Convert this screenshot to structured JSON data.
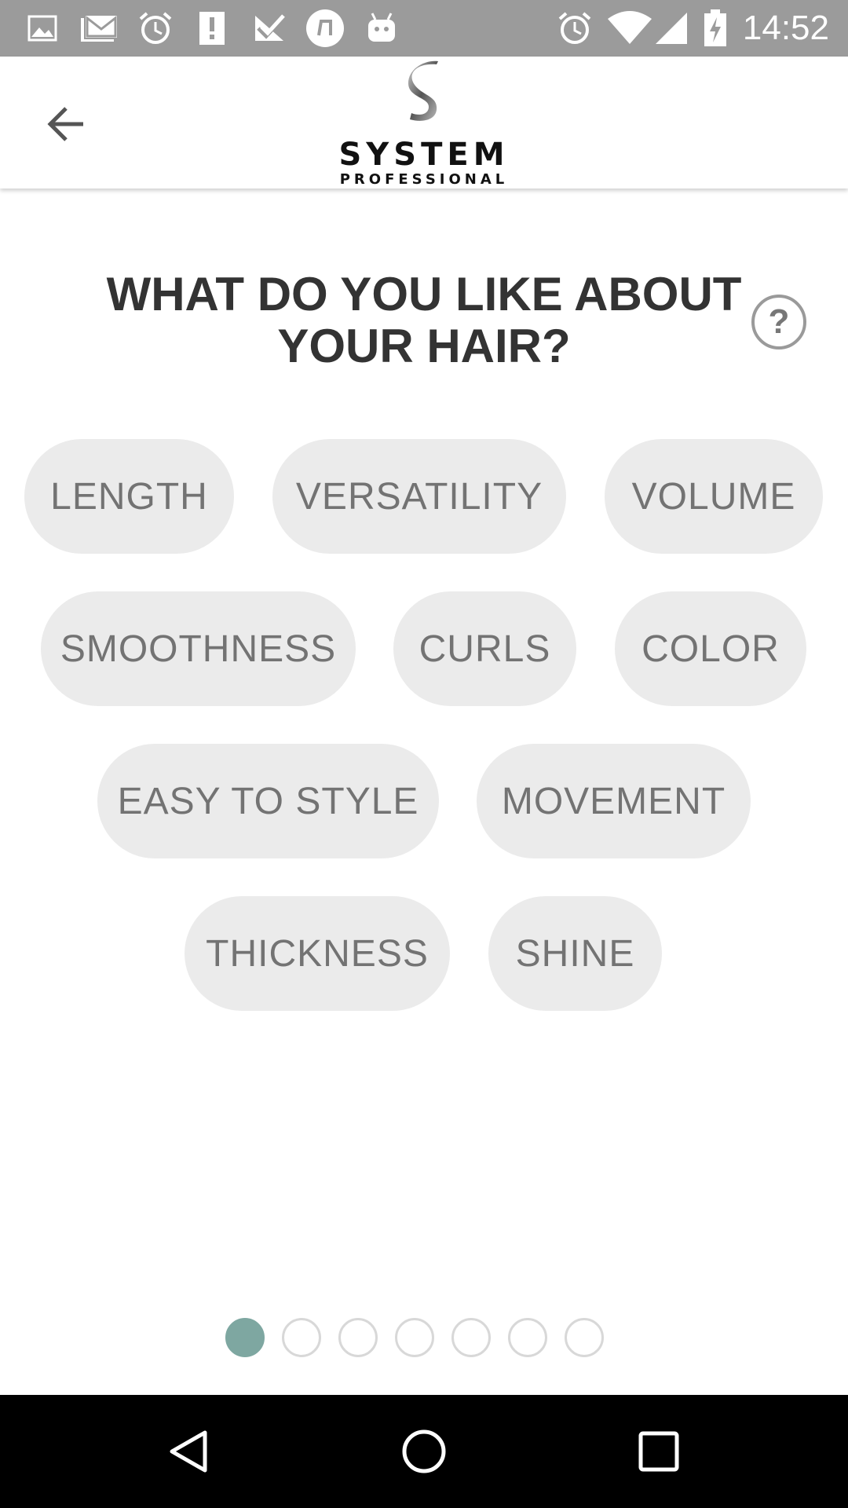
{
  "status_bar": {
    "time": "14:52",
    "left_icons": [
      "image-icon",
      "gmail-icon",
      "alarm-icon",
      "alert-icon",
      "check-icon",
      "music-icon",
      "android-icon"
    ],
    "right_icons": [
      "alarm-icon",
      "wifi-icon",
      "signal-icon",
      "battery-charging-icon"
    ]
  },
  "header": {
    "back_icon": "arrow-left-icon",
    "logo_word": "SYSTEM",
    "logo_sub": "PROFESSIONAL"
  },
  "question": {
    "text": "WHAT DO YOU LIKE ABOUT YOUR HAIR?",
    "help_label": "?"
  },
  "options": [
    {
      "label": "LENGTH"
    },
    {
      "label": "VERSATILITY"
    },
    {
      "label": "VOLUME"
    },
    {
      "label": "SMOOTHNESS"
    },
    {
      "label": "CURLS"
    },
    {
      "label": "COLOR"
    },
    {
      "label": "EASY TO STYLE"
    },
    {
      "label": "MOVEMENT"
    },
    {
      "label": "THICKNESS"
    },
    {
      "label": "SHINE"
    }
  ],
  "pager": {
    "total": 7,
    "current": 1
  },
  "colors": {
    "status_bar": "#9b9b9b",
    "chip_bg": "#ebebeb",
    "chip_text": "#737373",
    "heading": "#333333",
    "accent": "#7ea7a1"
  },
  "nav_bar": {
    "icons": [
      "back-triangle-icon",
      "home-circle-icon",
      "recents-square-icon"
    ]
  }
}
